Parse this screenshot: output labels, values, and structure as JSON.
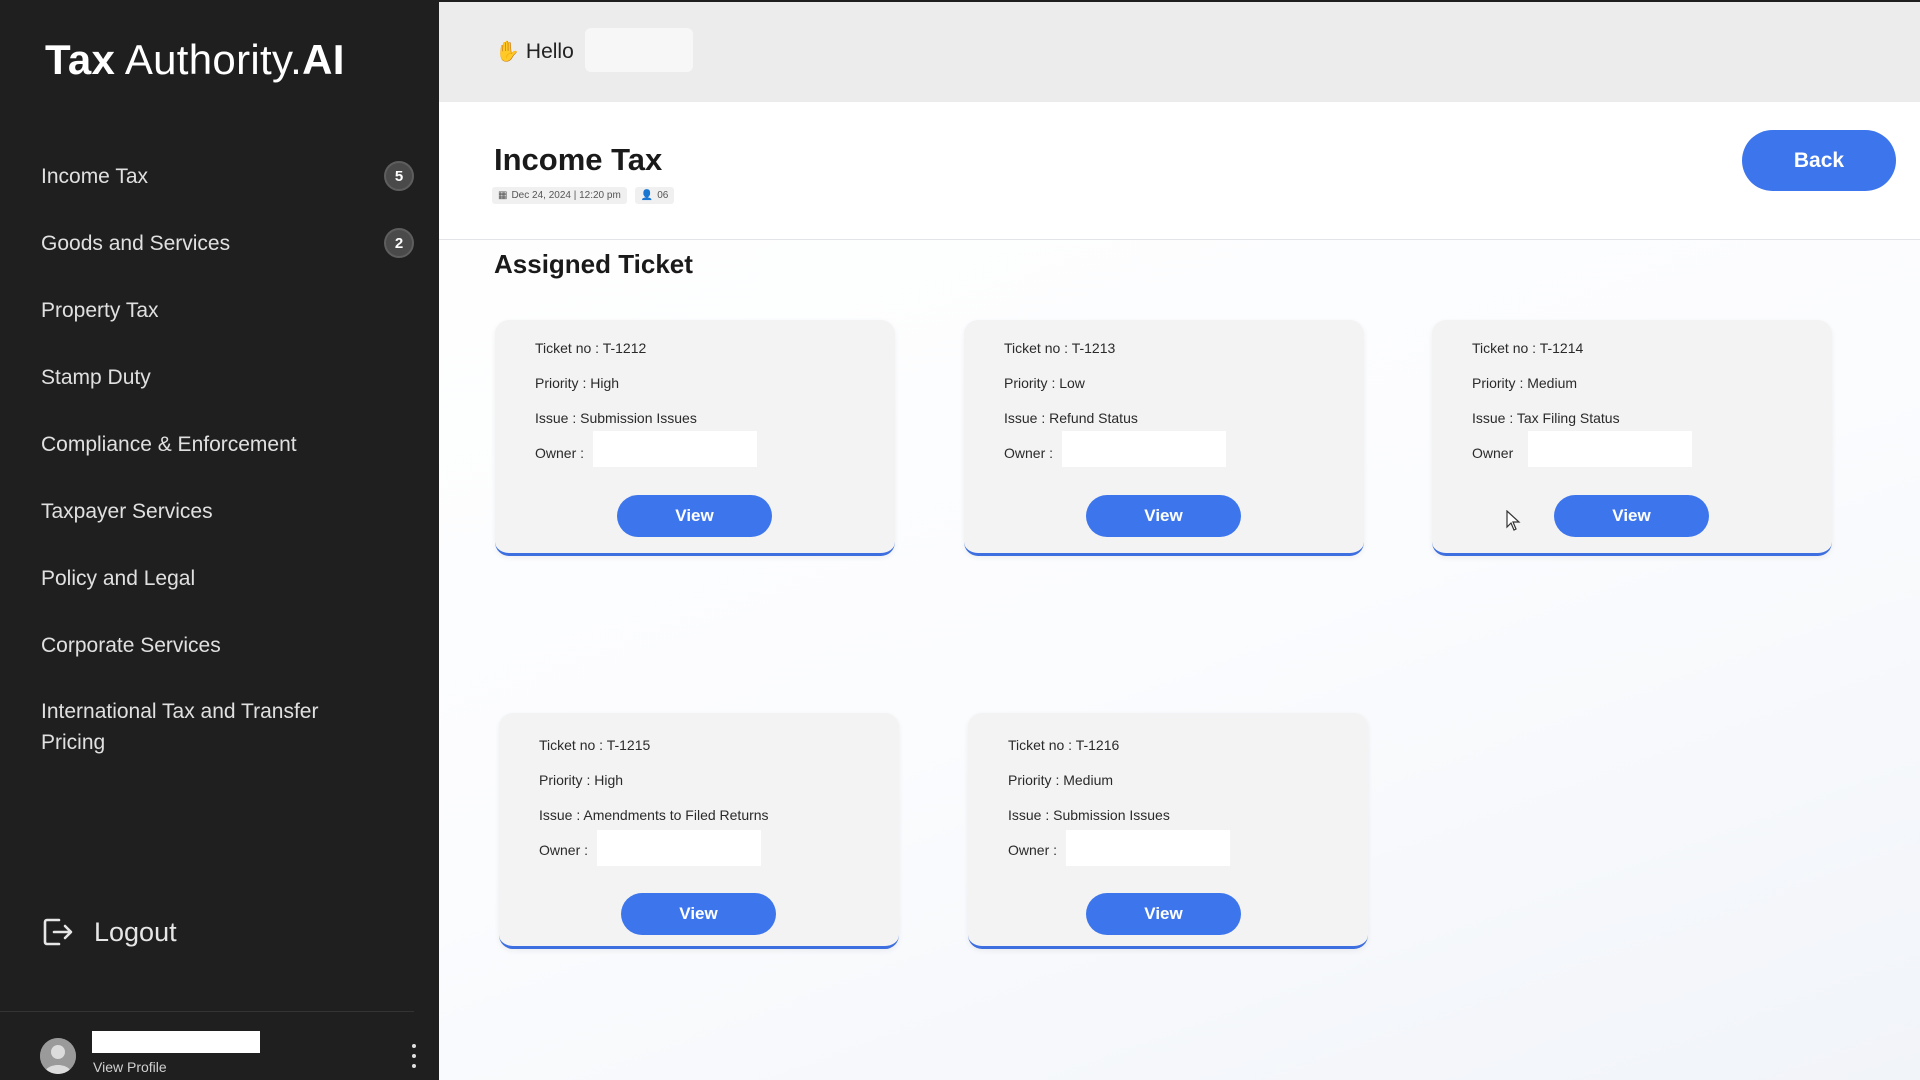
{
  "app": {
    "logo_bold": "Tax",
    "logo_light": "Authority.",
    "logo_suffix": "AI"
  },
  "sidebar": {
    "items": [
      {
        "label": "Income Tax",
        "badge": "5"
      },
      {
        "label": "Goods and Services",
        "badge": "2"
      },
      {
        "label": "Property Tax"
      },
      {
        "label": "Stamp Duty"
      },
      {
        "label": "Compliance & Enforcement"
      },
      {
        "label": "Taxpayer Services"
      },
      {
        "label": "Policy and Legal"
      },
      {
        "label": "Corporate Services"
      },
      {
        "label": "International Tax and Transfer Pricing"
      }
    ],
    "logout_label": "Logout",
    "view_profile_label": "View Profile"
  },
  "topbar": {
    "greeting": "Hello",
    "greeting_icon": "waving-hand-icon"
  },
  "page": {
    "title": "Income Tax",
    "date": "Dec 24, 2024 | 12:20 pm",
    "users_count": "06",
    "back_label": "Back",
    "section_title": "Assigned Ticket"
  },
  "tickets": [
    {
      "ticket_no": "Ticket no : T-1212",
      "priority": "Priority : High",
      "issue": "Issue : Submission Issues",
      "owner": "Owner :",
      "view_label": "View"
    },
    {
      "ticket_no": "Ticket no : T-1213",
      "priority": "Priority : Low",
      "issue": "Issue : Refund Status",
      "owner": "Owner :",
      "view_label": "View"
    },
    {
      "ticket_no": "Ticket no : T-1214",
      "priority": "Priority : Medium",
      "issue": "Issue : Tax Filing Status",
      "owner": "Owner",
      "view_label": "View"
    },
    {
      "ticket_no": "Ticket no : T-1215",
      "priority": "Priority : High",
      "issue": "Issue : Amendments to Filed Returns",
      "owner": "Owner :",
      "view_label": "View"
    },
    {
      "ticket_no": "Ticket no : T-1216",
      "priority": "Priority : Medium",
      "issue": "Issue : Submission Issues",
      "owner": "Owner :",
      "view_label": "View"
    }
  ],
  "colors": {
    "sidebar_bg": "#1f1f1f",
    "accent": "#3d76ec",
    "topbar_bg": "#ececec",
    "card_bg": "#f3f3f4"
  }
}
